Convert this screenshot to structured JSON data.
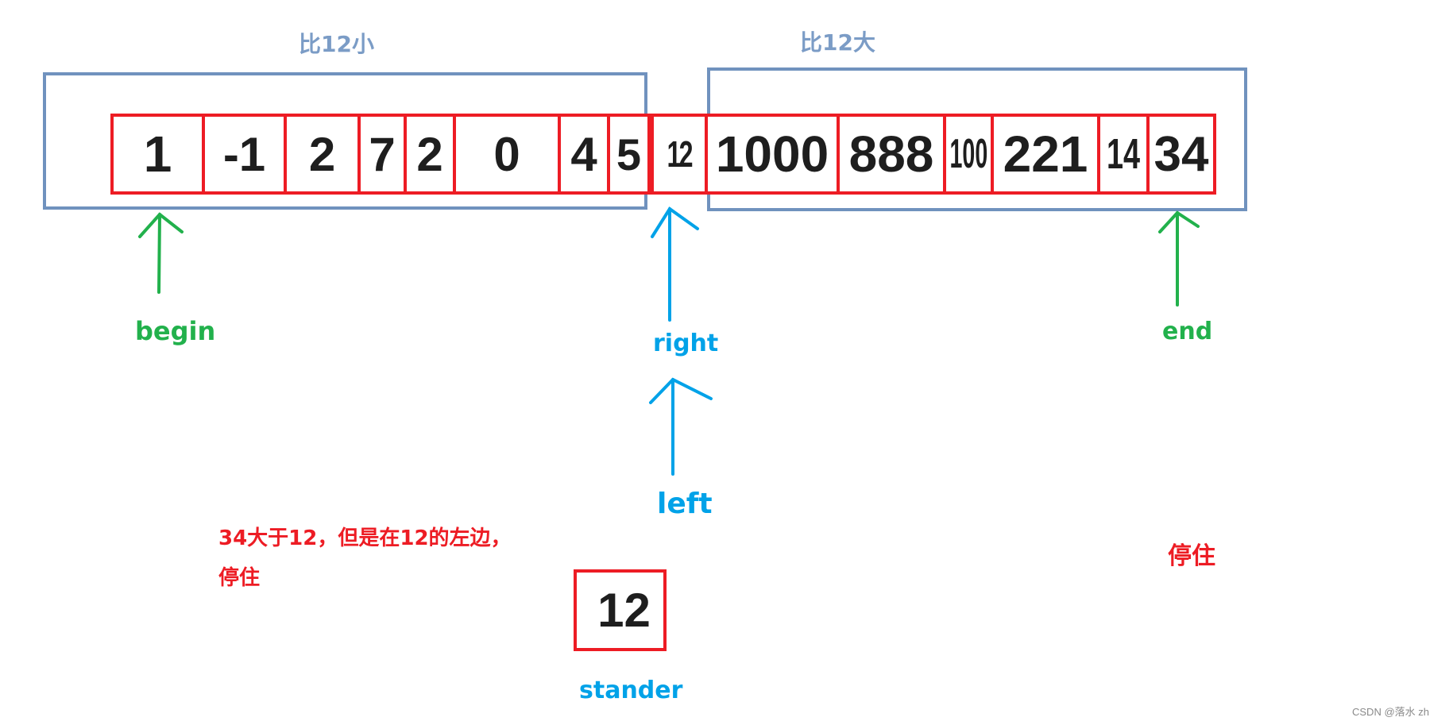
{
  "groups": {
    "smaller": {
      "label": "比12小"
    },
    "larger": {
      "label": "比12大"
    }
  },
  "array": [
    {
      "value": "1"
    },
    {
      "value": "-1"
    },
    {
      "value": "2"
    },
    {
      "value": "7"
    },
    {
      "value": "2"
    },
    {
      "value": "0"
    },
    {
      "value": "4"
    },
    {
      "value": "5"
    },
    {
      "value": "12"
    },
    {
      "value": "1000"
    },
    {
      "value": "888"
    },
    {
      "value": "100"
    },
    {
      "value": "221"
    },
    {
      "value": "14"
    },
    {
      "value": "34"
    }
  ],
  "pointers": {
    "begin": {
      "label": "begin",
      "color": "#22b14c"
    },
    "right": {
      "label": "right",
      "color": "#00a2e8"
    },
    "left": {
      "label": "left",
      "color": "#00a2e8"
    },
    "end": {
      "label": "end",
      "color": "#22b14c"
    }
  },
  "notes": {
    "left_note_line1": "34大于12，但是在12的左边，",
    "left_note_line2": "停住",
    "right_note": "停住"
  },
  "stander": {
    "value": "12",
    "label": "stander"
  },
  "watermark": "CSDN @落水 zh",
  "colors": {
    "group_border": "#7092be",
    "cell_border": "#ed1c24",
    "pointer_green": "#22b14c",
    "pointer_blue": "#00a2e8",
    "note_red": "#ed1c24"
  }
}
